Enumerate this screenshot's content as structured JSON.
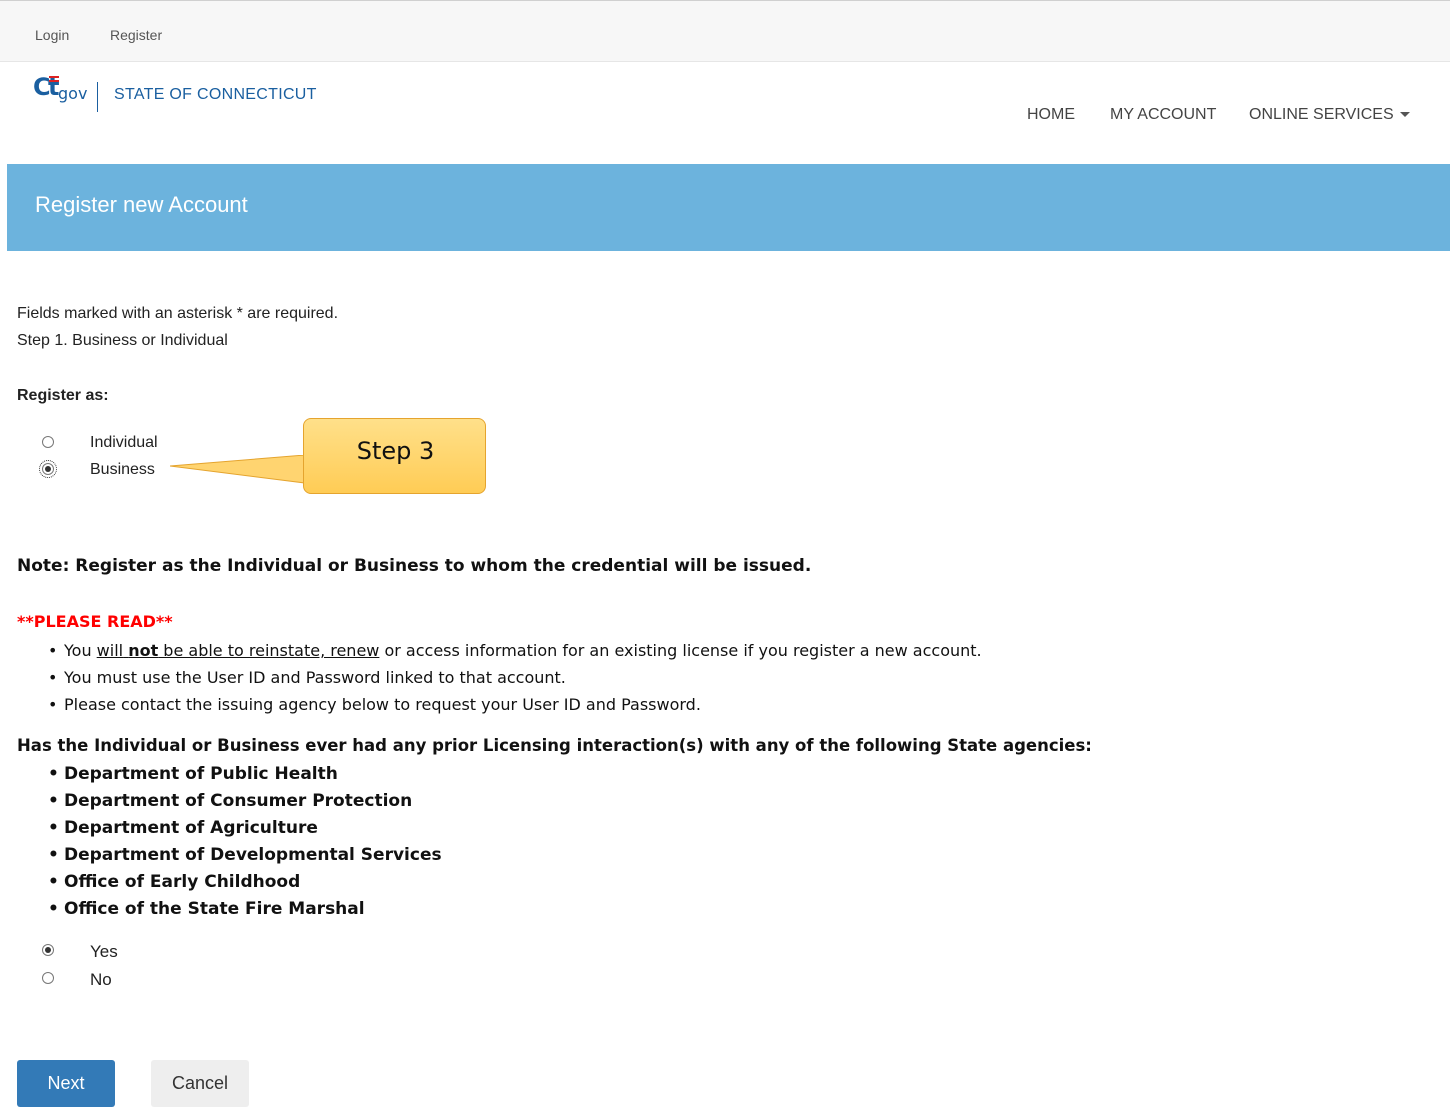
{
  "topbar": {
    "login": "Login",
    "register": "Register"
  },
  "header": {
    "logo_text": "CT.gov",
    "state_label": "STATE OF CONNECTICUT",
    "nav": {
      "home": "HOME",
      "my_account": "MY ACCOUNT",
      "online_services": "ONLINE SERVICES"
    }
  },
  "banner": {
    "title": "Register new Account"
  },
  "intro": {
    "required_note": "Fields marked with an asterisk * are required.",
    "step": "Step 1. Business or Individual"
  },
  "register_as": {
    "label": "Register as:",
    "options": [
      {
        "label": "Individual",
        "checked": false
      },
      {
        "label": "Business",
        "checked": true
      }
    ]
  },
  "callout": {
    "text": "Step 3"
  },
  "note": "Note: Register as the Individual or Business to whom the credential will be issued.",
  "please_read": {
    "title": "**PLEASE READ**",
    "bullet1": {
      "prefix": "You ",
      "will": "will",
      "not": "not",
      "middle": " be able to reinstate, renew",
      "suffix": " or access information for an existing license if you register a new account."
    },
    "bullet2": "You must use the User ID and Password linked to that account.",
    "bullet3": "Please contact the issuing agency below to request your User ID and Password."
  },
  "prior_licensing": {
    "question": "Has the Individual or Business ever had any prior Licensing interaction(s) with any of the following State agencies:",
    "agencies": [
      "Department of Public Health",
      "Department of Consumer Protection",
      "Department of Agriculture",
      "Department of Developmental Services",
      "Office of Early Childhood",
      "Office of the State Fire Marshal"
    ],
    "options": [
      {
        "label": "Yes",
        "checked": true
      },
      {
        "label": "No",
        "checked": false
      }
    ]
  },
  "buttons": {
    "next": "Next",
    "cancel": "Cancel"
  },
  "colors": {
    "banner": "#6cb3dd",
    "primary_button": "#337ab7",
    "warning": "#ff0000",
    "callout": "#ffd470"
  }
}
